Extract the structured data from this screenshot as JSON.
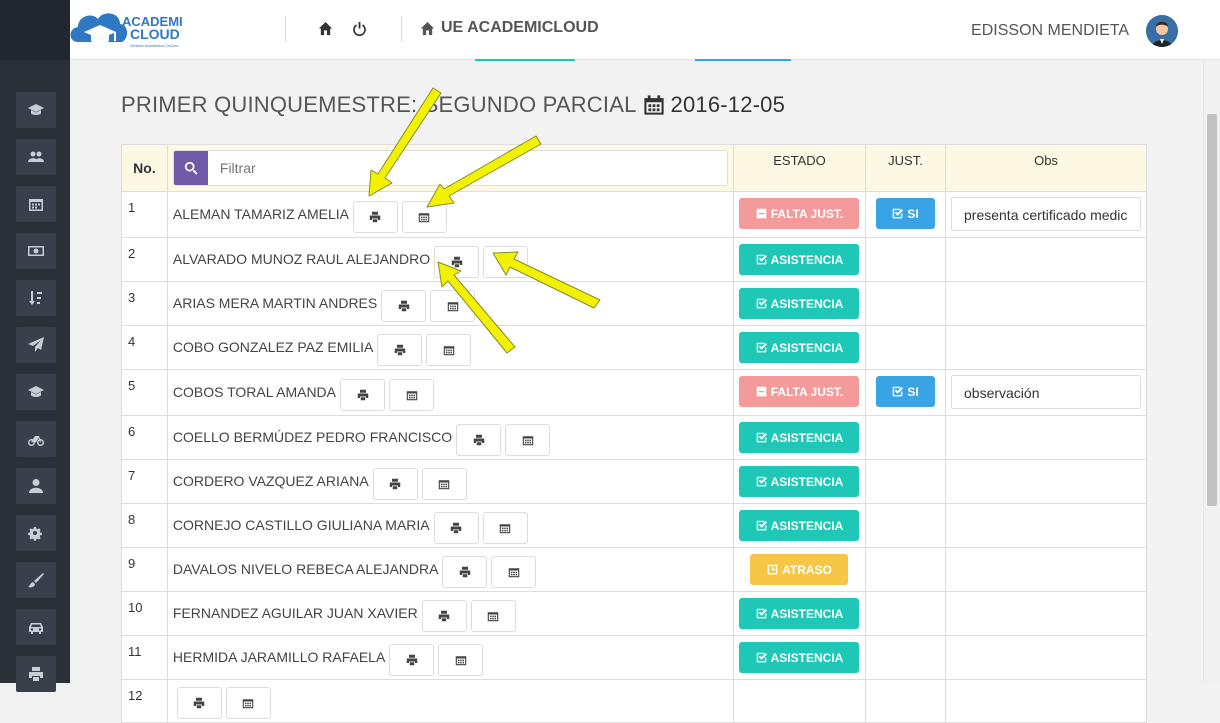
{
  "header": {
    "logo_line1": "ACADEMI",
    "logo_line2": "CLOUD",
    "logo_tagline": "Gestión Académica OnLine",
    "title": "UE ACADEMICLOUD",
    "user_name": "EDISSON MENDIETA"
  },
  "sidebar": {
    "items": [
      {
        "icon": "graduation-cap-icon"
      },
      {
        "icon": "users-icon"
      },
      {
        "icon": "calendar-icon"
      },
      {
        "icon": "money-icon"
      },
      {
        "icon": "sort-icon"
      },
      {
        "icon": "paper-plane-icon"
      },
      {
        "icon": "graduation-cap-icon"
      },
      {
        "icon": "bicycle-icon"
      },
      {
        "icon": "user-icon"
      },
      {
        "icon": "cogs-icon"
      },
      {
        "icon": "paint-brush-icon"
      },
      {
        "icon": "car-icon"
      },
      {
        "icon": "print-icon"
      }
    ]
  },
  "page": {
    "title": "PRIMER QUINQUEMESTRE: SEGUNDO PARCIAL",
    "date": "2016-12-05"
  },
  "table": {
    "headers": {
      "no": "No.",
      "filter_placeholder": "Filtrar",
      "estado": "ESTADO",
      "just": "JUST.",
      "obs": "Obs"
    },
    "rows": [
      {
        "num": "1",
        "name": "ALEMAN TAMARIZ AMELIA",
        "status": "FALTA JUST.",
        "status_type": "falta",
        "just": "SI",
        "obs": "presenta certificado medic"
      },
      {
        "num": "2",
        "name": "ALVARADO MUNOZ RAUL ALEJANDRO",
        "status": "ASISTENCIA",
        "status_type": "asis",
        "just": "",
        "obs": ""
      },
      {
        "num": "3",
        "name": "ARIAS MERA MARTIN ANDRES",
        "status": "ASISTENCIA",
        "status_type": "asis",
        "just": "",
        "obs": ""
      },
      {
        "num": "4",
        "name": "COBO GONZALEZ PAZ EMILIA",
        "status": "ASISTENCIA",
        "status_type": "asis",
        "just": "",
        "obs": ""
      },
      {
        "num": "5",
        "name": "COBOS TORAL AMANDA",
        "status": "FALTA JUST.",
        "status_type": "falta",
        "just": "SI",
        "obs": "observación"
      },
      {
        "num": "6",
        "name": "COELLO BERMÚDEZ PEDRO FRANCISCO",
        "status": "ASISTENCIA",
        "status_type": "asis",
        "just": "",
        "obs": ""
      },
      {
        "num": "7",
        "name": "CORDERO VAZQUEZ ARIANA",
        "status": "ASISTENCIA",
        "status_type": "asis",
        "just": "",
        "obs": ""
      },
      {
        "num": "8",
        "name": "CORNEJO CASTILLO GIULIANA MARIA",
        "status": "ASISTENCIA",
        "status_type": "asis",
        "just": "",
        "obs": ""
      },
      {
        "num": "9",
        "name": "DAVALOS NIVELO REBECA ALEJANDRA",
        "status": "ATRASO",
        "status_type": "atraso",
        "just": "",
        "obs": ""
      },
      {
        "num": "10",
        "name": "FERNANDEZ AGUILAR JUAN XAVIER",
        "status": "ASISTENCIA",
        "status_type": "asis",
        "just": "",
        "obs": ""
      },
      {
        "num": "11",
        "name": "HERMIDA JARAMILLO RAFAELA",
        "status": "ASISTENCIA",
        "status_type": "asis",
        "just": "",
        "obs": ""
      },
      {
        "num": "12",
        "name": "",
        "status": "",
        "status_type": "asis",
        "just": "",
        "obs": ""
      }
    ]
  },
  "colors": {
    "asistencia": "#1ec7b6",
    "falta_just": "#f59a9a",
    "atraso": "#f6c646",
    "si": "#3aa3e3",
    "filter_button": "#6f5aa7",
    "annotation_arrow": "#f2f200"
  }
}
